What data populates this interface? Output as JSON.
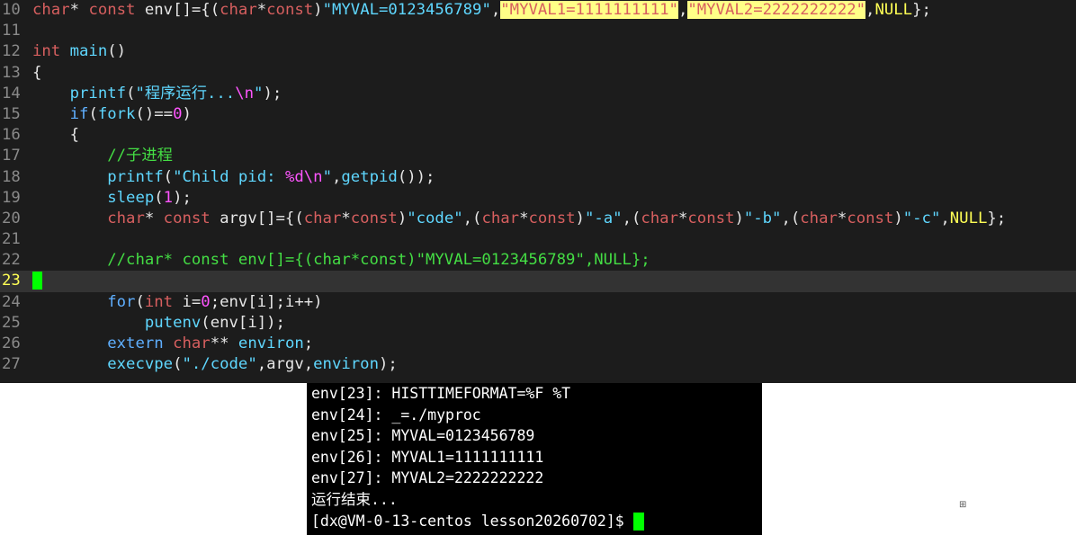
{
  "editor": {
    "lines": [
      {
        "n": "10",
        "p": [
          {
            "c": "ty",
            "t": "char"
          },
          {
            "c": "",
            "t": "* "
          },
          {
            "c": "ty",
            "t": "const"
          },
          {
            "c": "",
            "t": " env[]={("
          },
          {
            "c": "ty",
            "t": "char"
          },
          {
            "c": "",
            "t": "*"
          },
          {
            "c": "ty",
            "t": "const"
          },
          {
            "c": "",
            "t": ")"
          },
          {
            "c": "str",
            "t": "\"MYVAL=0123456789\""
          },
          {
            "c": "",
            "t": ","
          },
          {
            "c": "hl",
            "t": "\"MYVAL1=1111111111\""
          },
          {
            "c": "",
            "t": ","
          },
          {
            "c": "hl",
            "t": "\"MYVAL2=2222222222\""
          },
          {
            "c": "",
            "t": ","
          },
          {
            "c": "mac",
            "t": "NULL"
          },
          {
            "c": "",
            "t": "};"
          }
        ]
      },
      {
        "n": "11",
        "p": []
      },
      {
        "n": "12",
        "p": [
          {
            "c": "ty",
            "t": "int"
          },
          {
            "c": "",
            "t": " "
          },
          {
            "c": "fn",
            "t": "main"
          },
          {
            "c": "",
            "t": "()"
          }
        ]
      },
      {
        "n": "13",
        "p": [
          {
            "c": "",
            "t": "{"
          }
        ]
      },
      {
        "n": "14",
        "p": [
          {
            "c": "",
            "t": "    "
          },
          {
            "c": "fn",
            "t": "printf"
          },
          {
            "c": "",
            "t": "("
          },
          {
            "c": "str",
            "t": "\"程序运行..."
          },
          {
            "c": "esc",
            "t": "\\n"
          },
          {
            "c": "str",
            "t": "\""
          },
          {
            "c": "",
            "t": ");"
          }
        ]
      },
      {
        "n": "15",
        "p": [
          {
            "c": "",
            "t": "    "
          },
          {
            "c": "kw",
            "t": "if"
          },
          {
            "c": "",
            "t": "("
          },
          {
            "c": "fn",
            "t": "fork"
          },
          {
            "c": "",
            "t": "()=="
          },
          {
            "c": "num",
            "t": "0"
          },
          {
            "c": "",
            "t": ")"
          }
        ]
      },
      {
        "n": "16",
        "p": [
          {
            "c": "",
            "t": "    {"
          }
        ]
      },
      {
        "n": "17",
        "p": [
          {
            "c": "",
            "t": "        "
          },
          {
            "c": "cm",
            "t": "//子进程"
          }
        ]
      },
      {
        "n": "18",
        "p": [
          {
            "c": "",
            "t": "        "
          },
          {
            "c": "fn",
            "t": "printf"
          },
          {
            "c": "",
            "t": "("
          },
          {
            "c": "str",
            "t": "\"Child pid: "
          },
          {
            "c": "esc",
            "t": "%d\\n"
          },
          {
            "c": "str",
            "t": "\""
          },
          {
            "c": "",
            "t": ","
          },
          {
            "c": "fn",
            "t": "getpid"
          },
          {
            "c": "",
            "t": "());"
          }
        ]
      },
      {
        "n": "19",
        "p": [
          {
            "c": "",
            "t": "        "
          },
          {
            "c": "fn",
            "t": "sleep"
          },
          {
            "c": "",
            "t": "("
          },
          {
            "c": "num",
            "t": "1"
          },
          {
            "c": "",
            "t": ");"
          }
        ]
      },
      {
        "n": "20",
        "p": [
          {
            "c": "",
            "t": "        "
          },
          {
            "c": "ty",
            "t": "char"
          },
          {
            "c": "",
            "t": "* "
          },
          {
            "c": "ty",
            "t": "const"
          },
          {
            "c": "",
            "t": " argv[]={("
          },
          {
            "c": "ty",
            "t": "char"
          },
          {
            "c": "",
            "t": "*"
          },
          {
            "c": "ty",
            "t": "const"
          },
          {
            "c": "",
            "t": ")"
          },
          {
            "c": "str",
            "t": "\"code\""
          },
          {
            "c": "",
            "t": ",("
          },
          {
            "c": "ty",
            "t": "char"
          },
          {
            "c": "",
            "t": "*"
          },
          {
            "c": "ty",
            "t": "const"
          },
          {
            "c": "",
            "t": ")"
          },
          {
            "c": "str",
            "t": "\"-a\""
          },
          {
            "c": "",
            "t": ",("
          },
          {
            "c": "ty",
            "t": "char"
          },
          {
            "c": "",
            "t": "*"
          },
          {
            "c": "ty",
            "t": "const"
          },
          {
            "c": "",
            "t": ")"
          },
          {
            "c": "str",
            "t": "\"-b\""
          },
          {
            "c": "",
            "t": ",("
          },
          {
            "c": "ty",
            "t": "char"
          },
          {
            "c": "",
            "t": "*"
          },
          {
            "c": "ty",
            "t": "const"
          },
          {
            "c": "",
            "t": ")"
          },
          {
            "c": "str",
            "t": "\"-c\""
          },
          {
            "c": "",
            "t": ","
          },
          {
            "c": "mac",
            "t": "NULL"
          },
          {
            "c": "",
            "t": "};"
          }
        ]
      },
      {
        "n": "21",
        "p": []
      },
      {
        "n": "22",
        "p": [
          {
            "c": "",
            "t": "        "
          },
          {
            "c": "cm",
            "t": "//char* const env[]={(char*const)\"MYVAL=0123456789\",NULL};"
          }
        ]
      },
      {
        "n": "23",
        "p": [],
        "current": true
      },
      {
        "n": "24",
        "p": [
          {
            "c": "",
            "t": "        "
          },
          {
            "c": "kw",
            "t": "for"
          },
          {
            "c": "",
            "t": "("
          },
          {
            "c": "ty",
            "t": "int"
          },
          {
            "c": "",
            "t": " i="
          },
          {
            "c": "num",
            "t": "0"
          },
          {
            "c": "",
            "t": ";env[i];i++)"
          }
        ]
      },
      {
        "n": "25",
        "p": [
          {
            "c": "",
            "t": "            "
          },
          {
            "c": "fn",
            "t": "putenv"
          },
          {
            "c": "",
            "t": "(env[i]);"
          }
        ]
      },
      {
        "n": "26",
        "p": [
          {
            "c": "",
            "t": "        "
          },
          {
            "c": "kw",
            "t": "extern"
          },
          {
            "c": "",
            "t": " "
          },
          {
            "c": "ty",
            "t": "char"
          },
          {
            "c": "",
            "t": "** "
          },
          {
            "c": "fn",
            "t": "environ"
          },
          {
            "c": "",
            "t": ";"
          }
        ]
      },
      {
        "n": "27",
        "p": [
          {
            "c": "",
            "t": "        "
          },
          {
            "c": "fn",
            "t": "execvpe"
          },
          {
            "c": "",
            "t": "("
          },
          {
            "c": "str",
            "t": "\"./code\""
          },
          {
            "c": "",
            "t": ",argv,"
          },
          {
            "c": "fn",
            "t": "environ"
          },
          {
            "c": "",
            "t": ");"
          }
        ]
      }
    ]
  },
  "terminal": {
    "lines": [
      "env[23]: HISTTIMEFORMAT=%F %T",
      "env[24]: _=./myproc",
      "env[25]: MYVAL=0123456789",
      "env[26]: MYVAL1=1111111111",
      "env[27]: MYVAL2=2222222222",
      "运行结束..."
    ],
    "prompt": "[dx@VM-0-13-centos lesson20260702]$ "
  },
  "misc": {
    "icon_glyph": "⊞"
  }
}
